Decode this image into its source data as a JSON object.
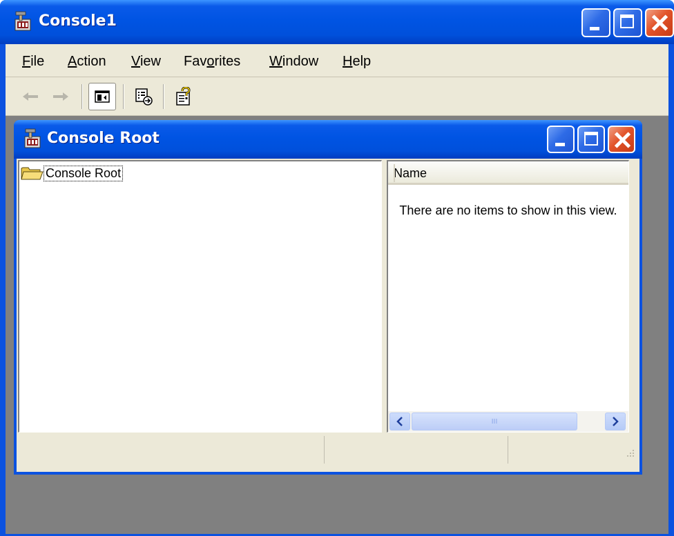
{
  "outer_window": {
    "title": "Console1",
    "icon": "mmc-console-icon"
  },
  "menubar": {
    "items": [
      {
        "label": "File",
        "mnemonic": "F"
      },
      {
        "label": "Action",
        "mnemonic": "A"
      },
      {
        "label": "View",
        "mnemonic": "V"
      },
      {
        "label": "Favorites",
        "mnemonic": "o"
      },
      {
        "label": "Window",
        "mnemonic": "W"
      },
      {
        "label": "Help",
        "mnemonic": "H"
      }
    ]
  },
  "toolbar": {
    "buttons": [
      {
        "name": "back-icon",
        "state": "disabled"
      },
      {
        "name": "forward-icon",
        "state": "disabled"
      },
      {
        "name": "show-hide-tree-icon",
        "state": "pressed"
      },
      {
        "name": "export-list-icon",
        "state": "normal"
      },
      {
        "name": "help-icon",
        "state": "normal"
      }
    ]
  },
  "inner_window": {
    "title": "Console Root",
    "icon": "mmc-console-icon"
  },
  "tree": {
    "root_label": "Console Root",
    "icon": "folder-open-icon"
  },
  "list": {
    "column_header": "Name",
    "empty_message": "There are no items to show in this view.",
    "scrollbar_thumb_glyph": "III"
  },
  "colors": {
    "title_blue": "#0054e3",
    "close_red": "#e2542a",
    "dialog_face": "#ece9d8",
    "mdi_background": "#808080"
  }
}
